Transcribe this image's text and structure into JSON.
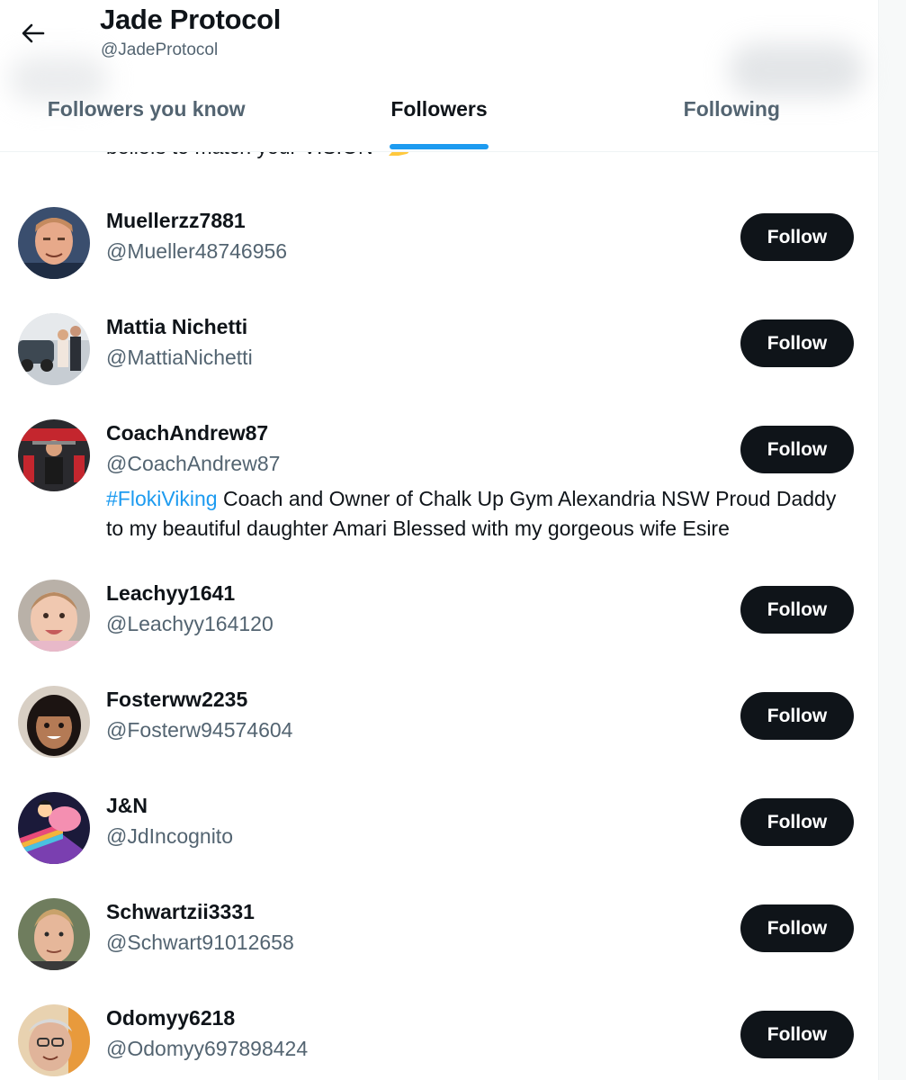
{
  "header": {
    "title": "Jade Protocol",
    "handle": "@JadeProtocol",
    "back_icon": "arrow-left-icon"
  },
  "tabs": [
    {
      "label": "Followers you know",
      "active": false
    },
    {
      "label": "Followers",
      "active": true
    },
    {
      "label": "Following",
      "active": false
    }
  ],
  "partial_bio": "beliefs to match your VISION",
  "follow_label": "Follow",
  "colors": {
    "accent": "#1d9bf0",
    "button": "#0f1419",
    "secondary_text": "#536471"
  },
  "followers": [
    {
      "name": "Muellerzz7881",
      "handle": "@Mueller48746956",
      "button": "Follow"
    },
    {
      "name": "Mattia Nichetti",
      "handle": "@MattiaNichetti",
      "button": "Follow"
    },
    {
      "name": "CoachAndrew87",
      "handle": "@CoachAndrew87",
      "button": "Follow",
      "bio_hashtag": "#FlokiViking",
      "bio_text": " Coach and Owner of Chalk Up Gym Alexandria NSW Proud Daddy to my beautiful daughter Amari Blessed with my gorgeous wife Esire"
    },
    {
      "name": "Leachyy1641",
      "handle": "@Leachyy164120",
      "button": "Follow"
    },
    {
      "name": "Fosterww2235",
      "handle": "@Fosterw94574604",
      "button": "Follow"
    },
    {
      "name": "J&N",
      "handle": "@JdIncognito",
      "button": "Follow"
    },
    {
      "name": "Schwartzii3331",
      "handle": "@Schwart91012658",
      "button": "Follow"
    },
    {
      "name": "Odomyy6218",
      "handle": "@Odomyy697898424",
      "button": "Follow"
    }
  ]
}
